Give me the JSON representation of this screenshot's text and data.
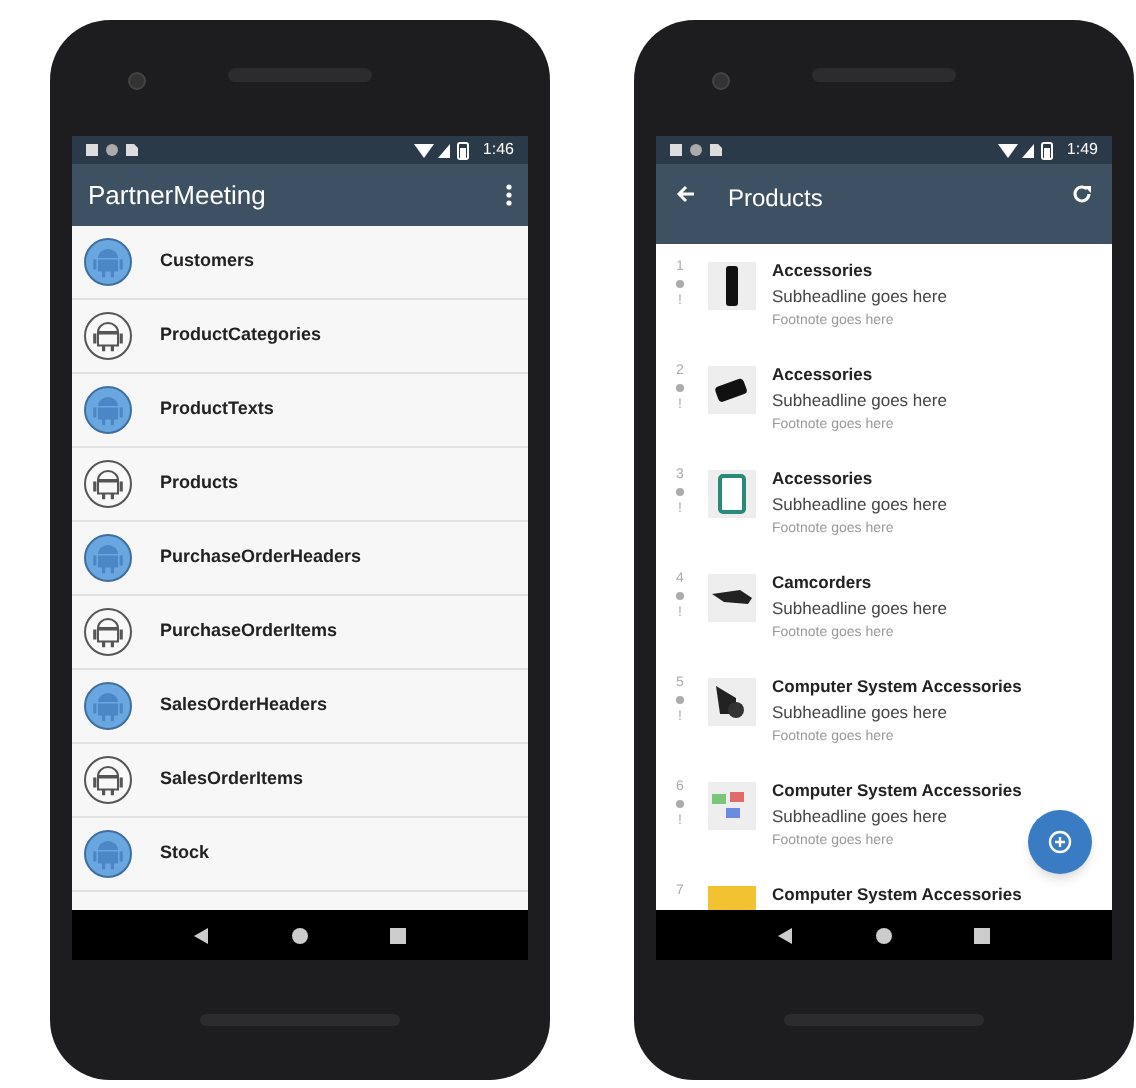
{
  "phones": [
    {
      "kind": "entity_list",
      "status_time": "1:46",
      "app_bar": {
        "title": "PartnerMeeting"
      },
      "items": [
        {
          "label": "Customers",
          "kind": "filled"
        },
        {
          "label": "ProductCategories",
          "kind": "outline"
        },
        {
          "label": "ProductTexts",
          "kind": "filled"
        },
        {
          "label": "Products",
          "kind": "outline"
        },
        {
          "label": "PurchaseOrderHeaders",
          "kind": "filled"
        },
        {
          "label": "PurchaseOrderItems",
          "kind": "outline"
        },
        {
          "label": "SalesOrderHeaders",
          "kind": "filled"
        },
        {
          "label": "SalesOrderItems",
          "kind": "outline"
        },
        {
          "label": "Stock",
          "kind": "filled"
        }
      ]
    },
    {
      "kind": "product_list",
      "status_time": "1:49",
      "app_bar": {
        "title": "Products"
      },
      "items": [
        {
          "index": "1",
          "mark": "!",
          "title": "Accessories",
          "subheadline": "Subheadline goes here",
          "footnote": "Footnote goes here"
        },
        {
          "index": "2",
          "mark": "!",
          "title": "Accessories",
          "subheadline": "Subheadline goes here",
          "footnote": "Footnote goes here"
        },
        {
          "index": "3",
          "mark": "!",
          "title": "Accessories",
          "subheadline": "Subheadline goes here",
          "footnote": "Footnote goes here"
        },
        {
          "index": "4",
          "mark": "!",
          "title": "Camcorders",
          "subheadline": "Subheadline goes here",
          "footnote": "Footnote goes here"
        },
        {
          "index": "5",
          "mark": "!",
          "title": "Computer System Accessories",
          "subheadline": "Subheadline goes here",
          "footnote": "Footnote goes here"
        },
        {
          "index": "6",
          "mark": "!",
          "title": "Computer System Accessories",
          "subheadline": "Subheadline goes here",
          "footnote": "Footnote goes here"
        },
        {
          "index": "7",
          "title": "Computer System Accessories"
        }
      ]
    }
  ]
}
